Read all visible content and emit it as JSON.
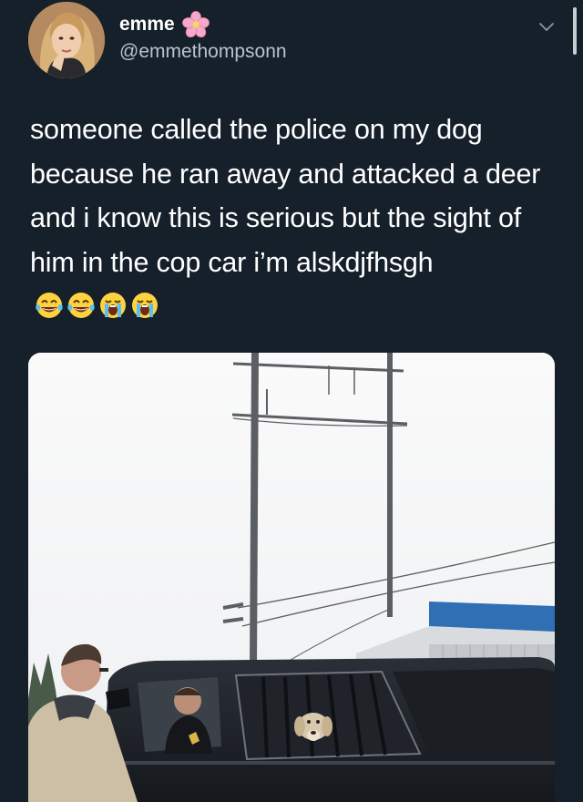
{
  "author": {
    "display_name": "emme",
    "handle": "@emmethompsonn",
    "name_emoji": "cherry-blossom-icon"
  },
  "tweet": {
    "text": "someone called the police on my dog because he ran away and attacked a deer and i know this is serious but the sight of him in the cop car i’m alskdjfhsgh",
    "emojis": [
      "tears-of-joy-icon",
      "tears-of-joy-icon",
      "loudly-crying-icon",
      "loudly-crying-icon"
    ]
  },
  "media": {
    "type": "photo",
    "icon": "photo"
  },
  "colors": {
    "background": "#15202b",
    "text": "#ffffff",
    "secondary": "#b9c3cd"
  }
}
